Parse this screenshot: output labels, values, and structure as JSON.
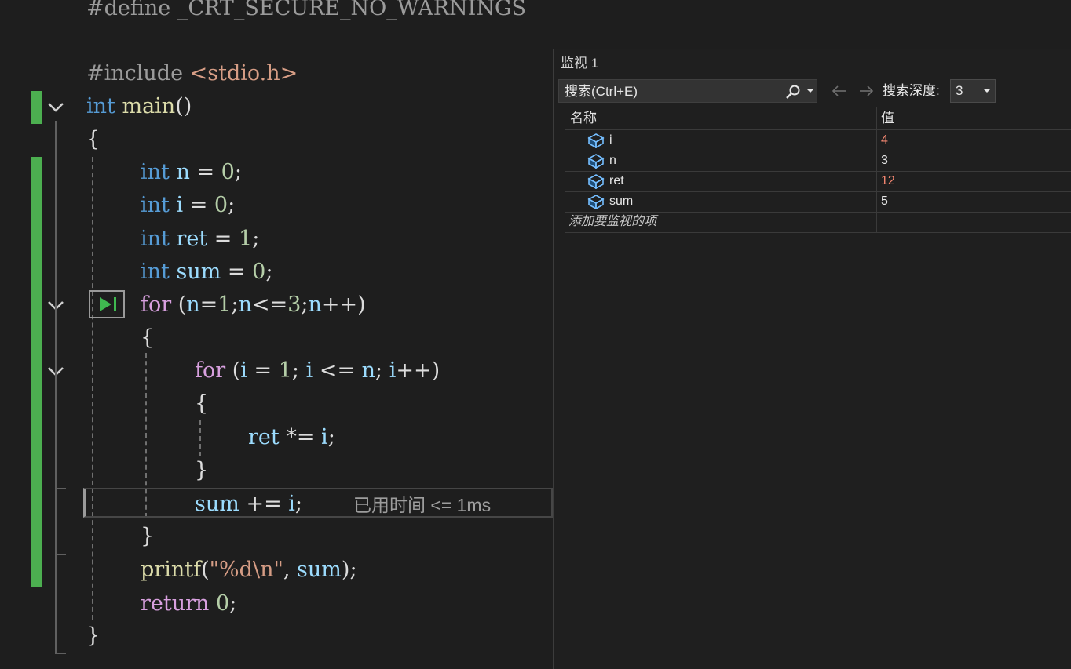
{
  "editor": {
    "lines": [
      {
        "id": "define",
        "tokens": [
          [
            "pre",
            "#define "
          ],
          [
            "pre",
            "_CRT_SECURE_NO_WARNINGS"
          ]
        ]
      },
      {
        "id": "include",
        "tokens": [
          [
            "pre",
            "#include "
          ],
          [
            "hdr",
            "<stdio.h>"
          ]
        ]
      },
      {
        "id": "main",
        "tokens": [
          [
            "kw",
            "int"
          ],
          [
            "punc",
            " "
          ],
          [
            "fn",
            "main"
          ],
          [
            "punc",
            "()"
          ]
        ]
      },
      {
        "id": "brace-open",
        "tokens": [
          [
            "punc",
            "{"
          ]
        ]
      },
      {
        "id": "decl-n",
        "tokens": [
          [
            "kw",
            "int"
          ],
          [
            "punc",
            " "
          ],
          [
            "var",
            "n"
          ],
          [
            "punc",
            " = "
          ],
          [
            "num",
            "0"
          ],
          [
            "punc",
            ";"
          ]
        ]
      },
      {
        "id": "decl-i",
        "tokens": [
          [
            "kw",
            "int"
          ],
          [
            "punc",
            " "
          ],
          [
            "var",
            "i"
          ],
          [
            "punc",
            " = "
          ],
          [
            "num",
            "0"
          ],
          [
            "punc",
            ";"
          ]
        ]
      },
      {
        "id": "decl-ret",
        "tokens": [
          [
            "kw",
            "int"
          ],
          [
            "punc",
            " "
          ],
          [
            "var",
            "ret"
          ],
          [
            "punc",
            " = "
          ],
          [
            "num",
            "1"
          ],
          [
            "punc",
            ";"
          ]
        ]
      },
      {
        "id": "decl-sum",
        "tokens": [
          [
            "kw",
            "int"
          ],
          [
            "punc",
            " "
          ],
          [
            "var",
            "sum"
          ],
          [
            "punc",
            " = "
          ],
          [
            "num",
            "0"
          ],
          [
            "punc",
            ";"
          ]
        ]
      },
      {
        "id": "for-outer",
        "tokens": [
          [
            "kw2",
            "for"
          ],
          [
            "punc",
            " ("
          ],
          [
            "var",
            "n"
          ],
          [
            "punc",
            "="
          ],
          [
            "num",
            "1"
          ],
          [
            "punc",
            ";"
          ],
          [
            "var",
            "n"
          ],
          [
            "punc",
            "<="
          ],
          [
            "num",
            "3"
          ],
          [
            "punc",
            ";"
          ],
          [
            "var",
            "n"
          ],
          [
            "punc",
            "++)"
          ]
        ]
      },
      {
        "id": "brace-outer-open",
        "tokens": [
          [
            "punc",
            "{"
          ]
        ]
      },
      {
        "id": "for-inner",
        "tokens": [
          [
            "kw2",
            "for"
          ],
          [
            "punc",
            " ("
          ],
          [
            "var",
            "i"
          ],
          [
            "punc",
            " = "
          ],
          [
            "num",
            "1"
          ],
          [
            "punc",
            "; "
          ],
          [
            "var",
            "i"
          ],
          [
            "punc",
            " <= "
          ],
          [
            "var",
            "n"
          ],
          [
            "punc",
            "; "
          ],
          [
            "var",
            "i"
          ],
          [
            "punc",
            "++)"
          ]
        ]
      },
      {
        "id": "brace-inner-open",
        "tokens": [
          [
            "punc",
            "{"
          ]
        ]
      },
      {
        "id": "ret-mul",
        "tokens": [
          [
            "var",
            "ret"
          ],
          [
            "punc",
            " *= "
          ],
          [
            "var",
            "i"
          ],
          [
            "punc",
            ";"
          ]
        ]
      },
      {
        "id": "brace-inner-close",
        "tokens": [
          [
            "punc",
            "}"
          ]
        ]
      },
      {
        "id": "sum-add",
        "tokens": [
          [
            "var",
            "sum"
          ],
          [
            "punc",
            " += "
          ],
          [
            "var",
            "i"
          ],
          [
            "punc",
            ";"
          ]
        ]
      },
      {
        "id": "brace-outer-close",
        "tokens": [
          [
            "punc",
            "}"
          ]
        ]
      },
      {
        "id": "printf",
        "tokens": [
          [
            "fn",
            "printf"
          ],
          [
            "punc",
            "("
          ],
          [
            "str",
            "\"%d\\n\""
          ],
          [
            "punc",
            ", "
          ],
          [
            "var",
            "sum"
          ],
          [
            "punc",
            ");"
          ]
        ]
      },
      {
        "id": "return",
        "tokens": [
          [
            "kw2",
            "return"
          ],
          [
            "punc",
            " "
          ],
          [
            "num",
            "0"
          ],
          [
            "punc",
            ";"
          ]
        ]
      },
      {
        "id": "brace-close",
        "tokens": [
          [
            "punc",
            "}"
          ]
        ]
      }
    ],
    "elapsed_label": "已用时间 <= 1ms"
  },
  "watch": {
    "title": "监视 1",
    "search_placeholder": "搜索(Ctrl+E)",
    "depth_label": "搜索深度:",
    "depth_value": "3",
    "columns": {
      "name": "名称",
      "value": "值"
    },
    "rows": [
      {
        "name": "i",
        "value": "4",
        "changed": true,
        "icon": "variable-icon"
      },
      {
        "name": "n",
        "value": "3",
        "changed": false,
        "icon": "variable-icon"
      },
      {
        "name": "ret",
        "value": "12",
        "changed": true,
        "icon": "variable-icon"
      },
      {
        "name": "sum",
        "value": "5",
        "changed": false,
        "icon": "variable-icon"
      }
    ],
    "add_item_label": "添加要监视的项"
  },
  "colors": {
    "changed_value": "#f48771",
    "keyword": "#569cd6",
    "control_keyword": "#d8a0df",
    "variable": "#9cdcfe",
    "function": "#dcdcaa",
    "number": "#b5cea8",
    "change_bar": "#4caf50"
  }
}
